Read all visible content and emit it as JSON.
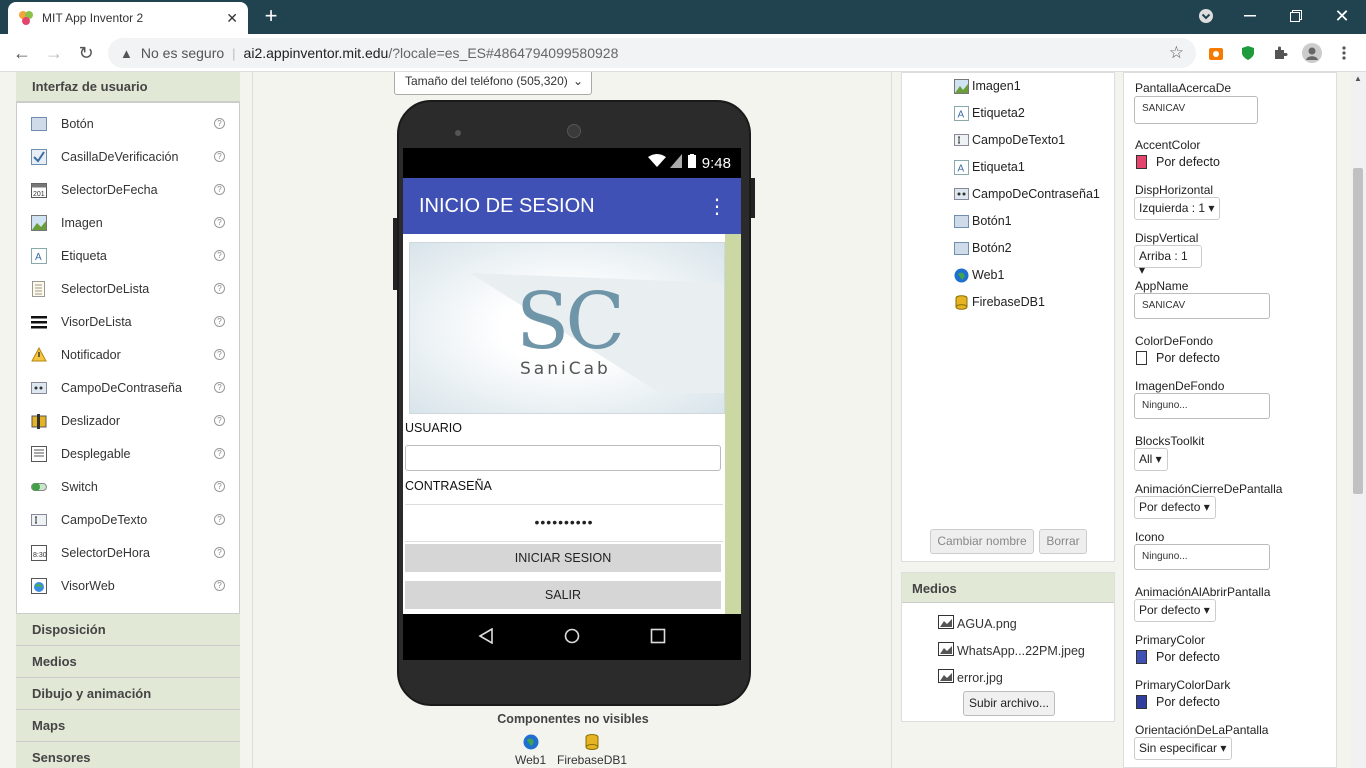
{
  "browser": {
    "tab_title": "MIT App Inventor 2",
    "security_text": "No es seguro",
    "url_host": "ai2.appinventor.mit.edu",
    "url_path": "/?locale=es_ES#4864794099580928"
  },
  "palette": {
    "header": "Interfaz de usuario",
    "items": [
      {
        "label": "Botón",
        "icon": "button-icon"
      },
      {
        "label": "CasillaDeVerificación",
        "icon": "checkbox-icon"
      },
      {
        "label": "SelectorDeFecha",
        "icon": "datepicker-icon"
      },
      {
        "label": "Imagen",
        "icon": "image-icon"
      },
      {
        "label": "Etiqueta",
        "icon": "label-icon"
      },
      {
        "label": "SelectorDeLista",
        "icon": "listpicker-icon"
      },
      {
        "label": "VisorDeLista",
        "icon": "listview-icon"
      },
      {
        "label": "Notificador",
        "icon": "notifier-icon"
      },
      {
        "label": "CampoDeContraseña",
        "icon": "password-icon"
      },
      {
        "label": "Deslizador",
        "icon": "slider-icon"
      },
      {
        "label": "Desplegable",
        "icon": "spinner-icon"
      },
      {
        "label": "Switch",
        "icon": "switch-icon"
      },
      {
        "label": "CampoDeTexto",
        "icon": "textbox-icon"
      },
      {
        "label": "SelectorDeHora",
        "icon": "timepicker-icon"
      },
      {
        "label": "VisorWeb",
        "icon": "webviewer-icon"
      }
    ],
    "help_symbol": "?",
    "categories": [
      "Disposición",
      "Medios",
      "Dibujo y animación",
      "Maps",
      "Sensores"
    ]
  },
  "viewer": {
    "size_select": "Tamaño del teléfono (505,320)",
    "status_time": "9:48",
    "app_title": "INICIO DE SESION",
    "menu_symbol": "⋮",
    "logo_letters": "SC",
    "logo_name": "SaniCab",
    "user_label": "USUARIO",
    "password_label": "CONTRASEÑA",
    "password_value": "••••••••••",
    "login_button": "INICIAR SESION",
    "exit_button": "SALIR",
    "nonvisible_title": "Componentes no visibles",
    "nonvisible": [
      "Web1",
      "FirebaseDB1"
    ]
  },
  "components": {
    "items": [
      {
        "label": "Imagen1",
        "icon": "image-icon"
      },
      {
        "label": "Etiqueta2",
        "icon": "label-icon"
      },
      {
        "label": "CampoDeTexto1",
        "icon": "textbox-icon"
      },
      {
        "label": "Etiqueta1",
        "icon": "label-icon"
      },
      {
        "label": "CampoDeContraseña1",
        "icon": "password-icon"
      },
      {
        "label": "Botón1",
        "icon": "button-icon"
      },
      {
        "label": "Botón2",
        "icon": "button-icon"
      },
      {
        "label": "Web1",
        "icon": "globe-icon"
      },
      {
        "label": "FirebaseDB1",
        "icon": "database-icon"
      }
    ],
    "rename_button": "Cambiar nombre",
    "delete_button": "Borrar"
  },
  "media": {
    "header": "Medios",
    "files": [
      "AGUA.png",
      "WhatsApp...22PM.jpeg",
      "error.jpg"
    ],
    "upload_button": "Subir archivo..."
  },
  "properties": {
    "about_label": "PantallaAcercaDe",
    "about_value": "SANICAV",
    "accent_label": "AccentColor",
    "accent_value": "Por defecto",
    "accent_color": "#e5446d",
    "halign_label": "DispHorizontal",
    "halign_value": "Izquierda : 1 ▾",
    "valign_label": "DispVertical",
    "valign_value": "Arriba : 1 ▾",
    "appname_label": "AppName",
    "appname_value": "SANICAV",
    "bgcolor_label": "ColorDeFondo",
    "bgcolor_value": "Por defecto",
    "bgimage_label": "ImagenDeFondo",
    "bgimage_value": "Ninguno...",
    "toolkit_label": "BlocksToolkit",
    "toolkit_value": "All ▾",
    "closeanim_label": "AnimaciónCierreDePantalla",
    "closeanim_value": "Por defecto ▾",
    "icon_label": "Icono",
    "icon_value": "Ninguno...",
    "openanim_label": "AnimaciónAlAbrirPantalla",
    "openanim_value": "Por defecto ▾",
    "primary_label": "PrimaryColor",
    "primary_value": "Por defecto",
    "primary_color": "#3f51b5",
    "primarydark_label": "PrimaryColorDark",
    "primarydark_value": "Por defecto",
    "primarydark_color": "#303f9f",
    "orientation_label": "OrientaciónDeLaPantalla",
    "orientation_value": "Sin especificar ▾"
  }
}
